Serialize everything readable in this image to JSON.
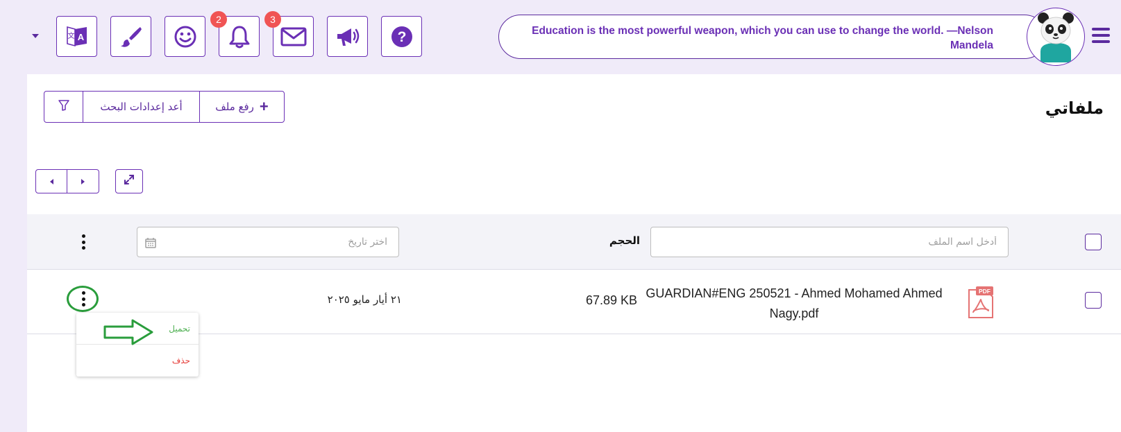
{
  "header": {
    "language_icon": "translate-icon",
    "theme_icon": "paint-brush-icon",
    "emoji_icon": "smiley-icon",
    "notifications": {
      "icon": "bell-icon",
      "count": "2"
    },
    "messages": {
      "icon": "envelope-icon",
      "count": "3"
    },
    "announcements_icon": "megaphone-icon",
    "help_icon": "question-circle-icon",
    "quote": "Education is the most powerful weapon, which you can use to change the world. —Nelson Mandela",
    "avatar_icon": "panda-avatar",
    "menu_icon": "hamburger-icon"
  },
  "page": {
    "title": "ملفاتي",
    "upload_label": "رفع ملف",
    "reset_label": "أعد إعدادات البحث",
    "filter_icon": "funnel-icon"
  },
  "filters": {
    "name_placeholder": "أدخل اسم الملف",
    "size_header": "الحجم",
    "date_placeholder": "اختر تاريخ"
  },
  "files": [
    {
      "name": "GUARDIAN#ENG 250521 - Ahmed Mohamed Ahmed Nagy.pdf",
      "type_badge": "PDF",
      "size": "67.89 KB",
      "date": "٢١ أيار مايو ٢٠٢٥"
    }
  ],
  "row_menu": {
    "download": "تحميل",
    "delete": "حذف"
  },
  "colors": {
    "brand": "#5b2a9e",
    "accent": "#6a2fb5",
    "badge": "#f05454",
    "annotation": "#2a9d3c",
    "download": "#4caf50",
    "delete": "#e53935",
    "pdf": "#e57373"
  }
}
